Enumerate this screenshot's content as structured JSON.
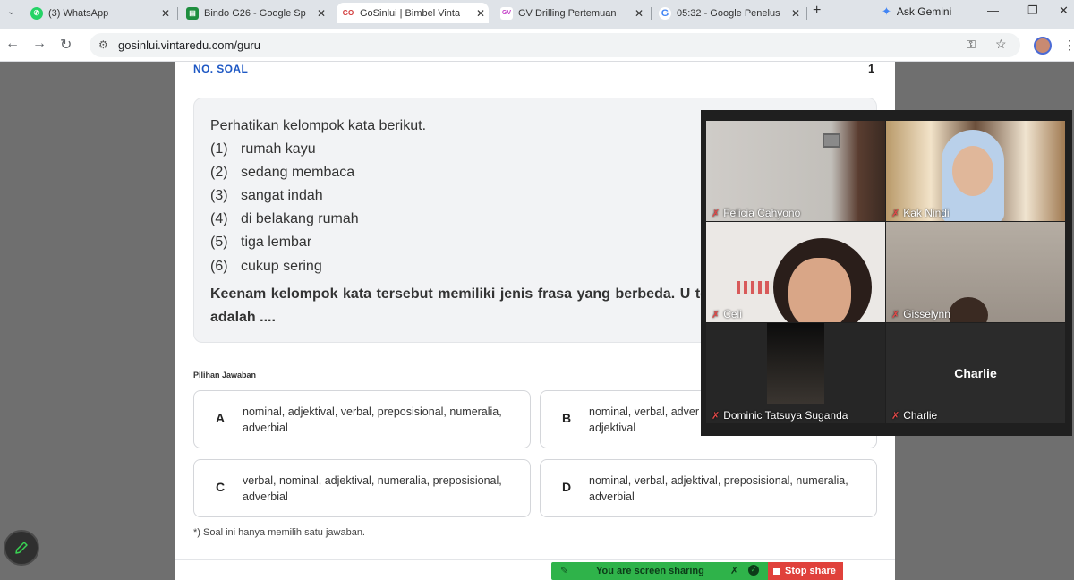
{
  "tabs": [
    {
      "title": "(3) WhatsApp",
      "icon": "whatsapp-icon",
      "active": false
    },
    {
      "title": "Bindo G26 - Google Sp",
      "icon": "sheets-icon",
      "active": false
    },
    {
      "title": "GoSinlui | Bimbel Vinta",
      "icon": "gosinlui-icon",
      "icon_text": "GO",
      "active": true
    },
    {
      "title": "GV Drilling Pertemuan",
      "icon": "gv-icon",
      "icon_text": "GV",
      "active": false
    },
    {
      "title": "05:32 - Google Penelus",
      "icon": "google-icon",
      "icon_text": "G",
      "active": false
    }
  ],
  "new_tab_label": "+",
  "gemini_label": "Ask Gemini",
  "address_bar": {
    "url": "gosinlui.vintaredu.com/guru"
  },
  "question": {
    "section_label": "NO. SOAL",
    "number": "1",
    "intro": "Perhatikan kelompok kata berikut.",
    "items": [
      {
        "num": "(1)",
        "text": "rumah kayu"
      },
      {
        "num": "(2)",
        "text": "sedang membaca"
      },
      {
        "num": "(3)",
        "text": "sangat indah"
      },
      {
        "num": "(4)",
        "text": "di belakang rumah"
      },
      {
        "num": "(5)",
        "text": "tiga lembar"
      },
      {
        "num": "(6)",
        "text": "cukup sering"
      }
    ],
    "prompt": "Keenam kelompok kata tersebut memiliki jenis frasa yang berbeda. U tepat untuk (1) sampai (6) adalah ...."
  },
  "answers": {
    "label": "Pilihan Jawaban",
    "options": [
      {
        "letter": "A",
        "text": "nominal, adjektival, verbal, preposisional, numeralia, adverbial"
      },
      {
        "letter": "B",
        "text": "nominal, verbal, adver adjektival"
      },
      {
        "letter": "C",
        "text": "verbal, nominal, adjektival, numeralia, preposisional, adverbial"
      },
      {
        "letter": "D",
        "text": "nominal, verbal, adjektival, preposisional, numeralia, adverbial"
      }
    ],
    "note": "*) Soal ini hanya memilih satu jawaban."
  },
  "participants": [
    {
      "name": "Felicia Cahyono",
      "muted": true,
      "bg": "#c9c6c2"
    },
    {
      "name": "Kak Nindi",
      "muted": true,
      "bg": "#8f6c4c"
    },
    {
      "name": "Celi",
      "muted": true,
      "bg": "#e9e6e3"
    },
    {
      "name": "Gisselynn",
      "muted": true,
      "bg": "#a9a29a"
    },
    {
      "name": "Dominic Tatsuya Suganda",
      "muted": true,
      "bg": "#262626"
    },
    {
      "name": "Charlie",
      "muted": true,
      "bg": "#2b2b2b",
      "avatar_label": "Charlie"
    }
  ],
  "share_bar": {
    "message": "You are screen sharing",
    "stop_label": "Stop share"
  },
  "colors": {
    "accent": "#1e58c4",
    "share_green": "#2fb34a",
    "stop_red": "#e0413b"
  }
}
